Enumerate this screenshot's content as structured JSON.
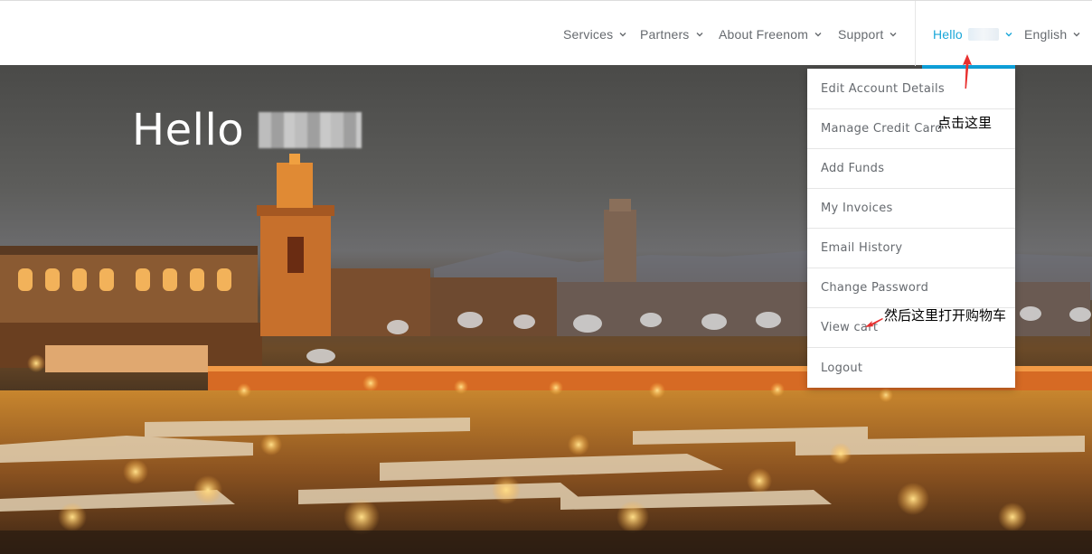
{
  "nav": {
    "items": [
      {
        "label": "Services"
      },
      {
        "label": "Partners"
      },
      {
        "label": "About Freenom"
      },
      {
        "label": "Support"
      }
    ],
    "account_label": "Hello",
    "language_label": "English"
  },
  "hero": {
    "greeting": "Hello"
  },
  "account_menu": {
    "items": [
      {
        "label": "Edit Account Details"
      },
      {
        "label": "Manage Credit Card"
      },
      {
        "label": "Add Funds"
      },
      {
        "label": "My Invoices"
      },
      {
        "label": "Email History"
      },
      {
        "label": "Change Password"
      },
      {
        "label": "View cart"
      },
      {
        "label": "Logout"
      }
    ]
  },
  "annotations": {
    "click_here": "点击这里",
    "then_open_cart": "然后这里打开购物车",
    "color": "#e8302f"
  },
  "colors": {
    "accent": "#1aa7d9",
    "nav_text": "#666a6f"
  }
}
